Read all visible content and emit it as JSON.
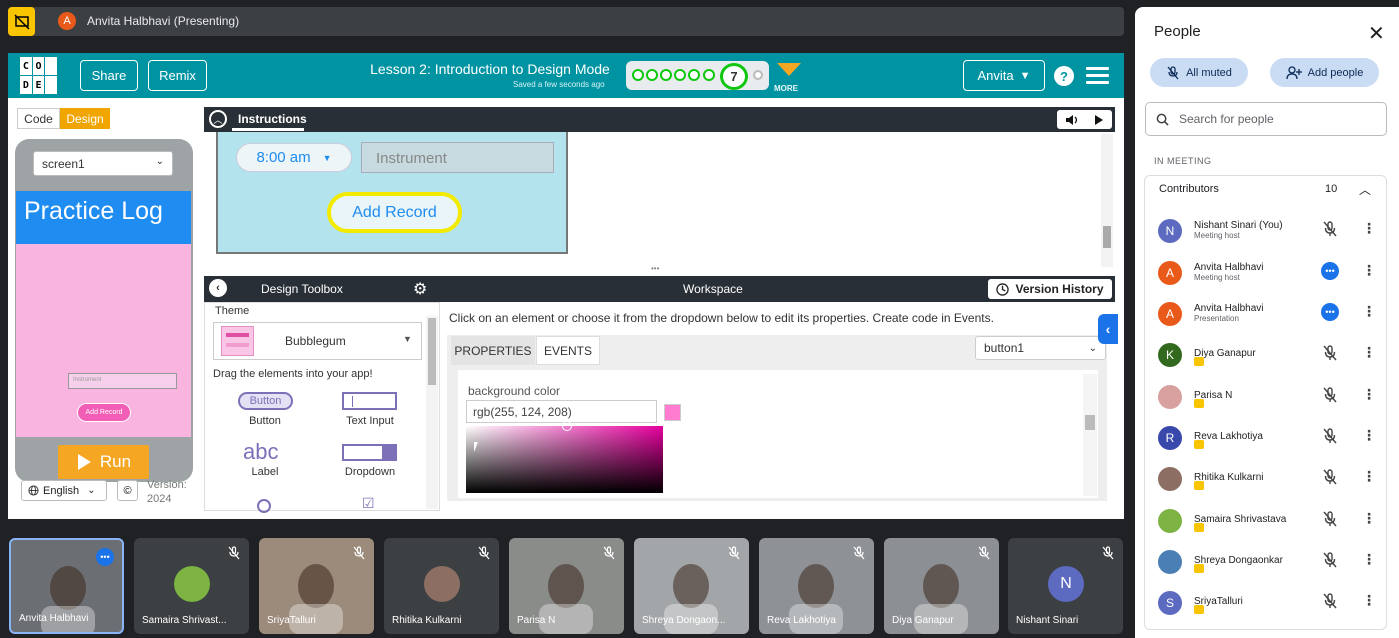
{
  "presenter_bar": {
    "avatar_letter": "A",
    "label": "Anvita Halbhavi (Presenting)"
  },
  "app": {
    "logo_letters": [
      "C",
      "O",
      "",
      "D",
      "E",
      ""
    ],
    "share_label": "Share",
    "remix_label": "Remix",
    "lesson_title": "Lesson 2: Introduction to Design Mode",
    "saved_status": "Saved a few seconds ago",
    "progress_level": "7",
    "more_label": "MORE",
    "user_name": "Anvita",
    "help_label": "?",
    "toggle_code": "Code",
    "toggle_design": "Design",
    "screen_select": "screen1",
    "preview_title": "Practice Log",
    "preview_input_placeholder": "Instrument",
    "preview_add_button": "Add Record",
    "run_label": "Run",
    "language": "English",
    "copyright_label": "©",
    "version_label": "Version:",
    "version_year": "2024"
  },
  "instructions": {
    "tab_label": "Instructions",
    "image_time_value": "8:00 am",
    "image_input_placeholder": "Instrument",
    "image_add_button": "Add Record"
  },
  "toolbox": {
    "title": "Design Toolbox",
    "theme_label": "Theme",
    "theme_value": "Bubblegum",
    "drag_hint": "Drag the elements into your app!",
    "items": [
      {
        "label": "Button",
        "preview": "Button"
      },
      {
        "label": "Text Input",
        "preview": ""
      },
      {
        "label": "Label",
        "preview": "abc"
      },
      {
        "label": "Dropdown",
        "preview": ""
      }
    ]
  },
  "workspace": {
    "title": "Workspace",
    "version_history_label": "Version History",
    "help_text": "Click on an element or choose it from the dropdown below to edit its properties. Create code in Events.",
    "tab_properties": "PROPERTIES",
    "tab_events": "EVENTS",
    "selected_element": "button1",
    "property_label": "background color",
    "property_value": "rgb(255, 124, 208)",
    "swatch_color": "#ff7cd0"
  },
  "people_panel": {
    "title": "People",
    "all_muted_label": "All muted",
    "add_people_label": "Add people",
    "search_placeholder": "Search for people",
    "section_label": "IN MEETING",
    "group_label": "Contributors",
    "group_count": "10",
    "participants": [
      {
        "letter": "N",
        "name": "Nishant Sinari (You)",
        "sub": "Meeting host",
        "color": "#5c6bc0",
        "state": "muted"
      },
      {
        "letter": "A",
        "name": "Anvita Halbhavi",
        "sub": "Meeting host",
        "color": "#e8591a",
        "state": "active"
      },
      {
        "letter": "A",
        "name": "Anvita Halbhavi",
        "sub": "Presentation",
        "color": "#e8591a",
        "state": "active"
      },
      {
        "letter": "K",
        "name": "Diya Ganapur",
        "sub": "",
        "color": "#33691e",
        "state": "muted"
      },
      {
        "letter": "",
        "name": "Parisa N",
        "sub": "",
        "color": "#d9a0a0",
        "state": "muted"
      },
      {
        "letter": "R",
        "name": "Reva Lakhotiya",
        "sub": "",
        "color": "#3949ab",
        "state": "muted"
      },
      {
        "letter": "",
        "name": "Rhitika Kulkarni",
        "sub": "",
        "color": "#8d6e63",
        "state": "muted"
      },
      {
        "letter": "",
        "name": "Samaira Shrivastava",
        "sub": "",
        "color": "#7cb342",
        "state": "muted"
      },
      {
        "letter": "",
        "name": "Shreya Dongaonkar",
        "sub": "",
        "color": "#4a7fb5",
        "state": "muted"
      },
      {
        "letter": "S",
        "name": "SriyaTalluri",
        "sub": "",
        "color": "#5c6bc0",
        "state": "muted"
      }
    ]
  },
  "tiles": [
    {
      "name": "Anvita Halbhavi",
      "bg": "#6b6e72",
      "avatar_letter": "",
      "avatar_color": ""
    },
    {
      "name": "Samaira Shrivast...",
      "bg": "#3c4043",
      "avatar_letter": "",
      "avatar_color": "#7cb342"
    },
    {
      "name": "SriyaTalluri",
      "bg": "#9c8a7a",
      "avatar_letter": "",
      "avatar_color": ""
    },
    {
      "name": "Rhitika Kulkarni",
      "bg": "#3c4043",
      "avatar_letter": "",
      "avatar_color": "#8d6e63"
    },
    {
      "name": "Parisa N",
      "bg": "#8a8c8a",
      "avatar_letter": "",
      "avatar_color": ""
    },
    {
      "name": "Shreya Dongaon...",
      "bg": "#a3a6a8",
      "avatar_letter": "",
      "avatar_color": ""
    },
    {
      "name": "Reva Lakhotiya",
      "bg": "#8e9296",
      "avatar_letter": "",
      "avatar_color": ""
    },
    {
      "name": "Diya Ganapur",
      "bg": "#8c8f93",
      "avatar_letter": "",
      "avatar_color": ""
    },
    {
      "name": "Nishant Sinari",
      "bg": "#3c4043",
      "avatar_letter": "N",
      "avatar_color": "#5c6bc0"
    }
  ]
}
